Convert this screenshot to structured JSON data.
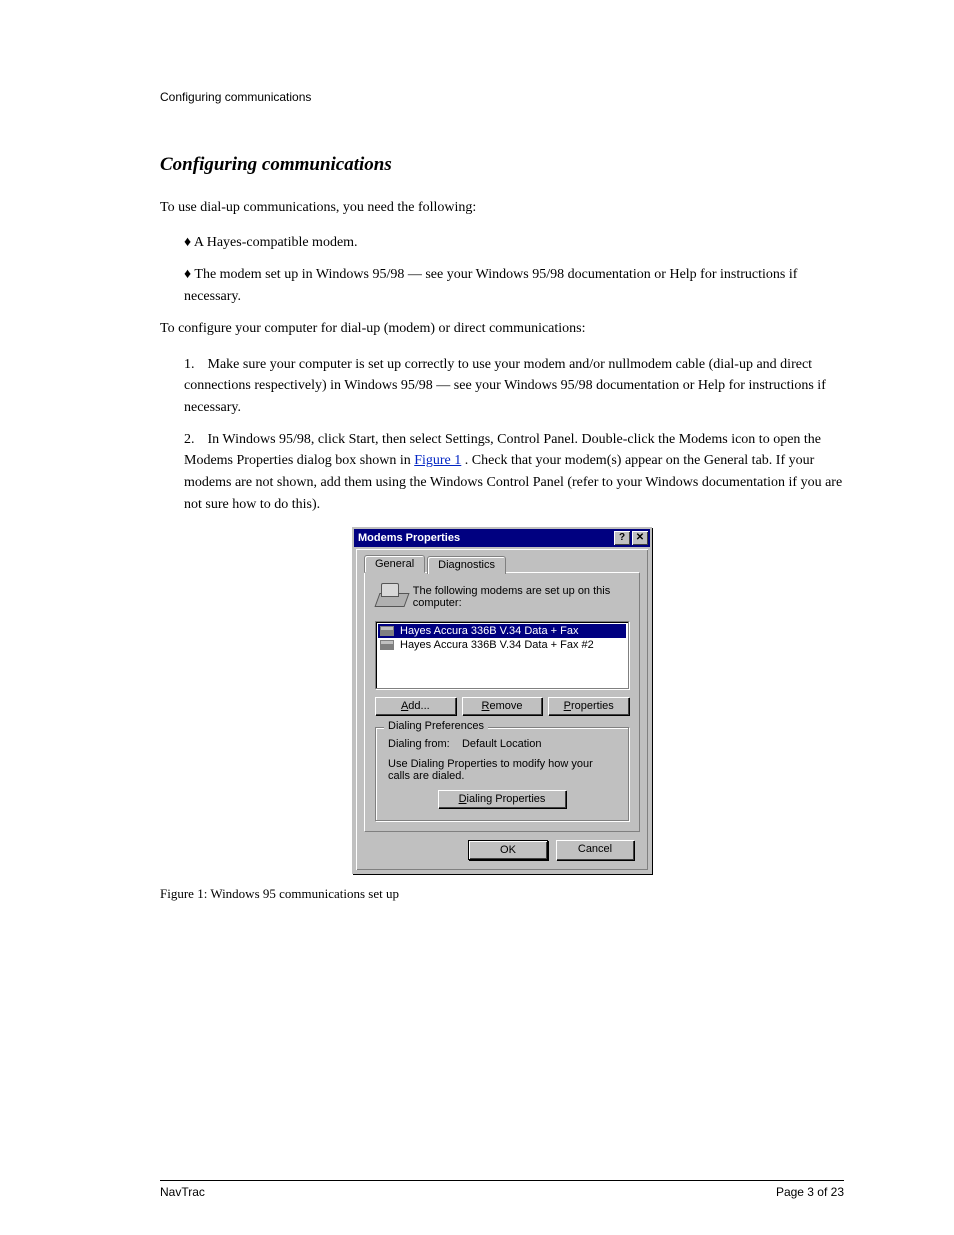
{
  "header": {
    "running": "Configuring communications"
  },
  "section": {
    "title": "Configuring communications"
  },
  "intro": "To use dial-up communications, you need the following:",
  "bullets": {
    "modem": "♦ A Hayes-compatible modem.",
    "setup": "♦ The modem set up in Windows 95/98 — see your Windows 95/98 documentation or Help for instructions if necessary."
  },
  "steps_lead": "To configure your computer for dial-up (modem) or direct communications:",
  "steps": {
    "s1_num": "1.",
    "s1": "Make sure your computer is set up correctly to use your modem and/or nullmodem cable (dial-up and direct connections respectively) in Windows 95/98 — see your Windows 95/98 documentation or Help for instructions if necessary.",
    "s2_num": "2.",
    "s2_pre": "In Windows 95/98, click Start, then select Settings, Control Panel. Double-click the Modems icon to open the Modems Properties dialog box shown in ",
    "s2_link": "Figure 1",
    "s2_post": ". Check that your modem(s) appear on the General tab. If your modems are not shown, add them using the Windows Control Panel (refer to your Windows documentation if you are not sure how to do this)."
  },
  "dialog": {
    "title": "Modems Properties",
    "help_glyph": "?",
    "close_glyph": "✕",
    "tabs": {
      "general": "General",
      "diagnostics": "Diagnostics"
    },
    "intro": "The following modems are set up on this computer:",
    "list": [
      "Hayes Accura 336B V.34 Data + Fax",
      "Hayes Accura 336B V.34 Data + Fax #2"
    ],
    "buttons": {
      "add": "Add...",
      "remove": "Remove",
      "properties": "Properties"
    },
    "group_title": "Dialing Preferences",
    "dialing_from_label": "Dialing from:",
    "dialing_from_value": "Default Location",
    "dialing_help": "Use Dialing Properties to modify how your calls are dialed.",
    "dialing_btn": "Dialing Properties",
    "ok": "OK",
    "cancel": "Cancel"
  },
  "figure_caption": "Figure 1:  Windows 95 communications set up",
  "footer": {
    "left": "NavTrac",
    "right": "Page 3 of 23"
  }
}
